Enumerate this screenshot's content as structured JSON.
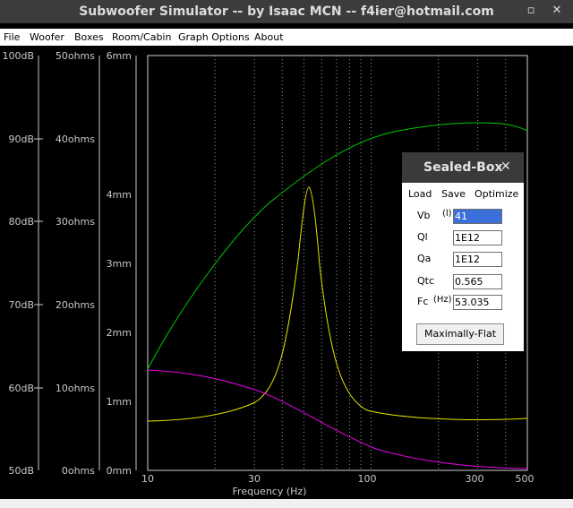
{
  "window": {
    "title": "Subwoofer Simulator -- by Isaac MCN -- f4ier@hotmail.com",
    "restore_glyph": "▫",
    "close_glyph": "✕"
  },
  "menu": {
    "items": [
      "File",
      "Woofer",
      "Boxes",
      "Room/Cabin",
      "Graph Options",
      "About"
    ]
  },
  "axes": {
    "db_ticks": [
      "100dB",
      "90dB",
      "80dB",
      "70dB",
      "60dB",
      "50dB"
    ],
    "ohm_ticks": [
      "50ohms",
      "40ohms",
      "30ohms",
      "20ohms",
      "10ohms",
      "0ohms"
    ],
    "mm_ticks": [
      "6mm",
      "4mm",
      "3mm",
      "2mm",
      "1mm",
      "0mm"
    ],
    "x_ticks": [
      "10",
      "30",
      "100",
      "300",
      "500"
    ],
    "x_label": "Frequency (Hz)",
    "x_range_hz": [
      10,
      500
    ]
  },
  "curves": {
    "spl_color": "#00c800",
    "impedance_color": "#e6e600",
    "excursion_color": "#e600e6"
  },
  "sealed_box": {
    "title": "Sealed-Box",
    "close_glyph": "✕",
    "menu": {
      "load": "Load",
      "save": "Save",
      "optimize": "Optimize"
    },
    "fields": {
      "vb_label": "Vb",
      "vb_unit": "(l)",
      "vb_value": "41",
      "ql_label": "Ql",
      "ql_value": "1E12",
      "qa_label": "Qa",
      "qa_value": "1E12",
      "qtc_label": "Qtc",
      "qtc_value": "0.565",
      "fc_label": "Fc",
      "fc_unit": "(Hz)",
      "fc_value": "53.035"
    },
    "button": "Maximally-Flat"
  }
}
